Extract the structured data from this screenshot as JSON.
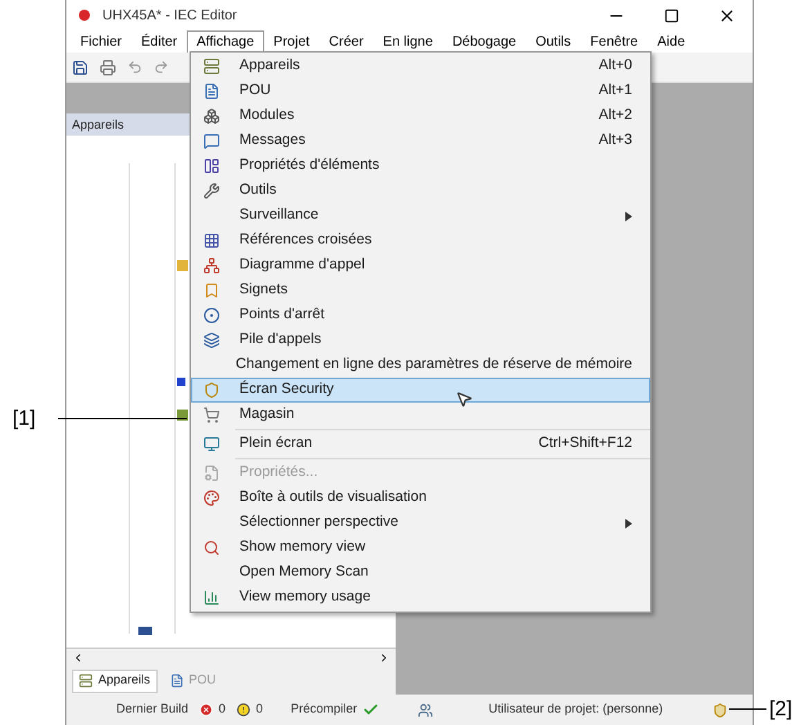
{
  "window": {
    "title": "UHX45A* - IEC Editor"
  },
  "menu_bar": [
    {
      "label": "Fichier",
      "selected": false
    },
    {
      "label": "Éditer",
      "selected": false
    },
    {
      "label": "Affichage",
      "selected": true
    },
    {
      "label": "Projet",
      "selected": false
    },
    {
      "label": "Créer",
      "selected": false
    },
    {
      "label": "En ligne",
      "selected": false
    },
    {
      "label": "Débogage",
      "selected": false
    },
    {
      "label": "Outils",
      "selected": false
    },
    {
      "label": "Fenêtre",
      "selected": false
    },
    {
      "label": "Aide",
      "selected": false
    }
  ],
  "panel": {
    "title": "Appareils",
    "tabs": [
      {
        "label": "Appareils",
        "selected": true
      },
      {
        "label": "POU",
        "selected": false
      }
    ]
  },
  "menu": [
    {
      "kind": "item",
      "label": "Appareils",
      "shortcut": "Alt+0",
      "submenu": false,
      "disabled": false,
      "selected": false
    },
    {
      "kind": "item",
      "label": "POU",
      "shortcut": "Alt+1",
      "submenu": false,
      "disabled": false,
      "selected": false
    },
    {
      "kind": "item",
      "label": "Modules",
      "shortcut": "Alt+2",
      "submenu": false,
      "disabled": false,
      "selected": false
    },
    {
      "kind": "item",
      "label": "Messages",
      "shortcut": "Alt+3",
      "submenu": false,
      "disabled": false,
      "selected": false
    },
    {
      "kind": "item",
      "label": "Propriétés d'éléments",
      "submenu": false,
      "disabled": false,
      "selected": false
    },
    {
      "kind": "item",
      "label": "Outils",
      "submenu": false,
      "disabled": false,
      "selected": false
    },
    {
      "kind": "item",
      "label": "Surveillance",
      "submenu": true,
      "disabled": false,
      "selected": false
    },
    {
      "kind": "item",
      "label": "Références croisées",
      "submenu": false,
      "disabled": false,
      "selected": false
    },
    {
      "kind": "item",
      "label": "Diagramme d'appel",
      "submenu": false,
      "disabled": false,
      "selected": false
    },
    {
      "kind": "item",
      "label": "Signets",
      "submenu": false,
      "disabled": false,
      "selected": false
    },
    {
      "kind": "item",
      "label": "Points d'arrêt",
      "submenu": false,
      "disabled": false,
      "selected": false
    },
    {
      "kind": "item",
      "label": "Pile d'appels",
      "submenu": false,
      "disabled": false,
      "selected": false
    },
    {
      "kind": "item",
      "label": "Changement en ligne des paramètres de réserve de mémoire",
      "submenu": false,
      "disabled": false,
      "selected": false
    },
    {
      "kind": "item",
      "label": "Écran Security",
      "submenu": false,
      "disabled": false,
      "selected": true
    },
    {
      "kind": "item",
      "label": "Magasin",
      "submenu": false,
      "disabled": false,
      "selected": false
    },
    {
      "kind": "separator"
    },
    {
      "kind": "item",
      "label": "Plein écran",
      "shortcut": "Ctrl+Shift+F12",
      "submenu": false,
      "disabled": false,
      "selected": false
    },
    {
      "kind": "separator"
    },
    {
      "kind": "item",
      "label": "Propriétés...",
      "submenu": false,
      "disabled": true,
      "selected": false
    },
    {
      "kind": "item",
      "label": "Boîte à outils de visualisation",
      "submenu": false,
      "disabled": false,
      "selected": false
    },
    {
      "kind": "item",
      "label": "Sélectionner perspective",
      "submenu": true,
      "disabled": false,
      "selected": false
    },
    {
      "kind": "item",
      "label": "Show memory view",
      "submenu": false,
      "disabled": false,
      "selected": false
    },
    {
      "kind": "item",
      "label": "Open Memory Scan",
      "submenu": false,
      "disabled": false,
      "selected": false
    },
    {
      "kind": "item",
      "label": "View memory usage",
      "submenu": false,
      "disabled": false,
      "selected": false
    }
  ],
  "status_bar": {
    "build_label": "Dernier Build",
    "errors": "0",
    "warnings": "0",
    "precompile_label": "Précompiler",
    "user": "Utilisateur de projet: (personne)"
  },
  "callouts": [
    {
      "label": "[1]"
    },
    {
      "label": "[2]"
    }
  ]
}
